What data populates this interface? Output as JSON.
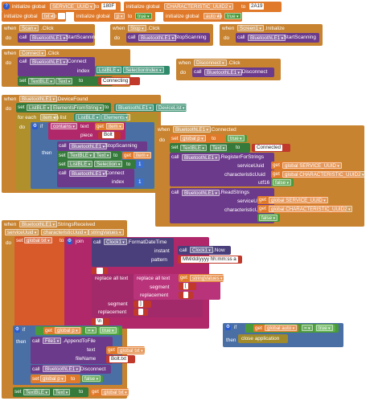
{
  "globals": {
    "g1_kw": "initialize global",
    "g1_name": "SERVICE_UUID",
    "g1_to": "to",
    "g1_val": "180F",
    "g2_kw": "initialize global",
    "g2_name": "CHARACTERISTIC_UUID2",
    "g2_to": "to",
    "g2_val": "2A19",
    "g3_kw": "initialize global",
    "g3_name": "txt",
    "g3_to": "to",
    "g3_val": "",
    "g4_kw": "initialize global",
    "g4_name": "p",
    "g4_to": "to",
    "g4_val": "true",
    "g5_kw": "initialize global",
    "g5_name": "auto",
    "g5_to": "to",
    "g5_val": "true"
  },
  "scan": {
    "when": "when",
    "comp": "Scan",
    "event": ".Click",
    "do": "do",
    "call": "call",
    "target": "BluetoothLE1",
    "method": ".StartScanning"
  },
  "stop": {
    "when": "when",
    "comp": "Stop",
    "event": ".Click",
    "do": "do",
    "call": "call",
    "target": "BluetoothLE1",
    "method": ".StopScanning"
  },
  "screen": {
    "when": "when",
    "comp": "Screen1",
    "event": ".Initialize",
    "do": "do",
    "call": "call",
    "target": "BluetoothLE1",
    "method": ".StartScanning"
  },
  "connect": {
    "when": "when",
    "comp": "Connect",
    "event": ".Click",
    "do": "do",
    "call": "call",
    "target": "BluetoothLE1",
    "method": ".Connect",
    "index": "index",
    "lb": "ListBLE",
    "prop": "SelectionIndex",
    "set": "set",
    "text_comp": "TextBLE",
    "text_prop": "Text",
    "to": "to",
    "connecting": "Connecting"
  },
  "disconnect": {
    "when": "when",
    "comp": "Disconnect",
    "event": ".Click",
    "do": "do",
    "call": "call",
    "target": "BluetoothLE1",
    "method": ".Disconnect"
  },
  "found": {
    "when": "when",
    "comp": "BluetoothLE1",
    "event": ".DeviceFound",
    "do": "do",
    "set": "set",
    "lb": "ListBLE",
    "prop": "ElementsFromString",
    "to": "to",
    "ble": "BluetoothLE1",
    "devlist": "DeviceList",
    "for_each": "for each",
    "item": "item",
    "in_list": "in list",
    "lb2": "ListBLE",
    "elements": "Elements",
    "do2": "do",
    "if": "if",
    "contains": "contains",
    "text_kw": "text",
    "get": "get",
    "get_item": "item",
    "piece": "piece",
    "piece_val": "Bolt",
    "then": "then",
    "call": "call",
    "stop_method": ".StopScanning",
    "text_comp": "TextBLE",
    "text_prop": "Text",
    "get_item2": "item",
    "sel_prop": "Selection",
    "sel_val": "1",
    "connect_method": ".Connect",
    "index_kw": "index",
    "index_val": "1"
  },
  "connected": {
    "when": "when",
    "comp": "BluetoothLE1",
    "event": ".Connected",
    "do": "do",
    "set": "set",
    "gvar": "global p",
    "to": "to",
    "true": "true",
    "text_comp": "TextBLE",
    "text_prop": "Text",
    "status": "Connected",
    "call": "call",
    "reg": ".RegisterForStrings",
    "svc_kw": "serviceUuid",
    "get": "get",
    "svc_var": "global SERVICE_UUID",
    "chr_kw": "characteristicUuid",
    "chr_var": "global CHARACTERISTIC_UUID2",
    "utf_kw": "utf16",
    "false": "false",
    "read": ".ReadStrings",
    "svc_var2": "global SERVICE_UUID",
    "chr_var2": "global CHARACTERISTIC_UUID2"
  },
  "received": {
    "when": "when",
    "comp": "BluetoothLE1",
    "event": ".StringsReceived",
    "p1": "serviceUuid",
    "p2": "characteristicUuid",
    "p3": "stringValues",
    "do": "do",
    "set": "set",
    "gtxt": "global txt",
    "to": "to",
    "join": "join",
    "call": "call",
    "clock": "Clock1",
    "fmt": ".FormatDateTime",
    "instant": "instant",
    "now": ".Now",
    "pattern": "pattern",
    "pattern_val": "MM/dd/yyyy hh:mm:ss a",
    "sep": "",
    "replace": "replace all text",
    "segment": "segment",
    "seg1": "[",
    "replacement": "replacement",
    "rep1": "",
    "get": "get",
    "sv": "stringValues",
    "seg2": "]",
    "rep2": "",
    "nl": "\\n",
    "if": "if",
    "gp": "global p",
    "eq": "=",
    "true": "true",
    "then": "then",
    "file": "File1",
    "append": ".AppendToFile",
    "text_kw": "text",
    "gtxt2": "global txt",
    "filename": "fileName",
    "fn_val": "Bolt.txt",
    "ble": "BluetoothLE1",
    "disc": ".Disconnect",
    "gvar_p": "global p",
    "false": "false",
    "text_comp": "TextBLE",
    "text_prop": "Text",
    "gtxt3": "global txt"
  },
  "auto": {
    "if": "if",
    "get": "get",
    "gauto": "global auto",
    "eq": "=",
    "true": "true",
    "then": "then",
    "close": "close application"
  }
}
